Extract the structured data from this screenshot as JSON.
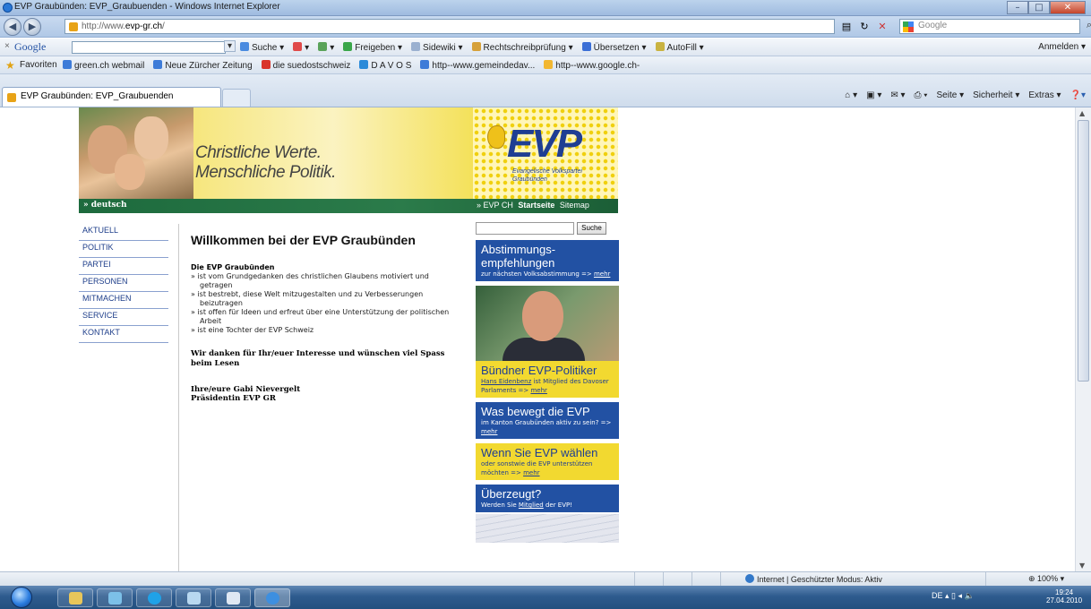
{
  "window": {
    "title": "EVP Graubünden: EVP_Graubuenden - Windows Internet Explorer",
    "url_prefix": "http://www.",
    "url_domain": "evp-gr.ch",
    "url_suffix": "/",
    "search_placeholder": "Google",
    "search_engine_icon": "google-icon"
  },
  "google_toolbar": {
    "close": "×",
    "logo": "Google",
    "items": [
      "Suche ▾",
      "▾",
      "▾",
      "Freigeben ▾",
      "Sidewiki ▾",
      "Rechtschreibprüfung ▾",
      "Übersetzen ▾",
      "AutoFill ▾"
    ],
    "signin": "Anmelden ▾"
  },
  "favorites": {
    "label": "Favoriten",
    "links": [
      "green.ch webmail",
      "Neue Zürcher Zeitung",
      "die suedostschweiz",
      "D A V O S",
      "http--www.gemeindedav...",
      "http--www.google.ch-"
    ]
  },
  "tab": {
    "title": "EVP Graubünden: EVP_Graubuenden"
  },
  "commandbar": [
    "Seite ▾",
    "Sicherheit ▾",
    "Extras ▾"
  ],
  "banner": {
    "slogan_line1": "Christliche Werte.",
    "slogan_line2": "Menschliche Politik.",
    "logo_text": "EVP",
    "logo_sub1": "Evangelische Volkspartei",
    "logo_sub2": "Graubünden",
    "language": "» deutsch",
    "nav_evp": "» EVP CH",
    "nav_start": "Startseite",
    "nav_sitemap": "Sitemap"
  },
  "menu": [
    "AKTUELL",
    "POLITIK",
    "PARTEI",
    "PERSONEN",
    "MITMACHEN",
    "SERVICE",
    "KONTAKT"
  ],
  "main": {
    "heading": "Willkommen bei der EVP Graubünden",
    "intro": "Die EVP Graubünden",
    "bullets": [
      "» ist vom Grundgedanken des christlichen Glaubens motiviert und getragen",
      "» ist bestrebt, diese Welt mitzugestalten und zu Verbesserungen beizutragen",
      "» ist offen für Ideen und erfreut über eine Unterstützung der politischen Arbeit",
      "» ist eine Tochter der EVP Schweiz"
    ],
    "thanks": "Wir danken für Ihr/euer Interesse und wünschen viel Spass beim Lesen",
    "sig_line1": "Ihre/eure Gabi Nievergelt",
    "sig_line2": "Präsidentin EVP GR"
  },
  "sidebar": {
    "search_button": "Suche",
    "box1_title": "Abstimmungs-empfehlungen",
    "box1_text": "zur nächsten Volksabstimmung => ",
    "box1_link": "mehr",
    "box2_title": "Bündner EVP-Politiker",
    "box2_link_name": "Hans Eidenbenz",
    "box2_text": " ist Mitglied des Davoser Parlaments => ",
    "box2_link": "mehr",
    "box3_title": "Was bewegt die EVP",
    "box3_text": "im Kanton Graubünden aktiv zu sein? => ",
    "box3_link": "mehr",
    "box4_title": "Wenn Sie EVP wählen",
    "box4_text": "oder sonstwie die EVP unterstützen möchten => ",
    "box4_link": "mehr",
    "box5_title": "Überzeugt?",
    "box5_text_pre": "Werden Sie ",
    "box5_link": "Mitglied",
    "box5_text_post": " der EVP!"
  },
  "status": {
    "zone": "Internet | Geschützter Modus: Aktiv",
    "zoom": "100%"
  },
  "taskbar": {
    "lang": "DE",
    "time": "19:24",
    "date": "27.04.2010"
  }
}
